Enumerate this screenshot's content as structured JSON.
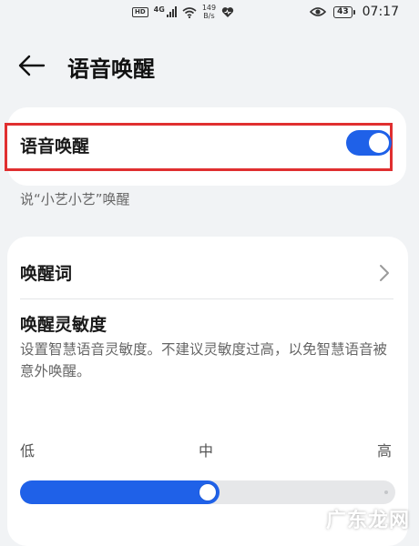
{
  "status_bar": {
    "hd": "HD",
    "network": "4G",
    "speed_value": "149",
    "speed_unit": "B/s",
    "battery": "43",
    "time": "07:17"
  },
  "header": {
    "title": "语音唤醒"
  },
  "voice_wakeup": {
    "label": "语音唤醒",
    "enabled": true
  },
  "hint": "说“小艺小艺”唤醒",
  "wake_word": {
    "label": "唤醒词"
  },
  "sensitivity": {
    "title": "唤醒灵敏度",
    "description": "设置智慧语音灵敏度。不建议灵敏度过高，以免智慧语音被意外唤醒。",
    "levels": [
      "低",
      "中",
      "高"
    ],
    "value_fraction": 0.5
  },
  "colors": {
    "accent": "#1f61e8",
    "highlight_border": "#e02f30"
  },
  "watermark": "广东龙网"
}
